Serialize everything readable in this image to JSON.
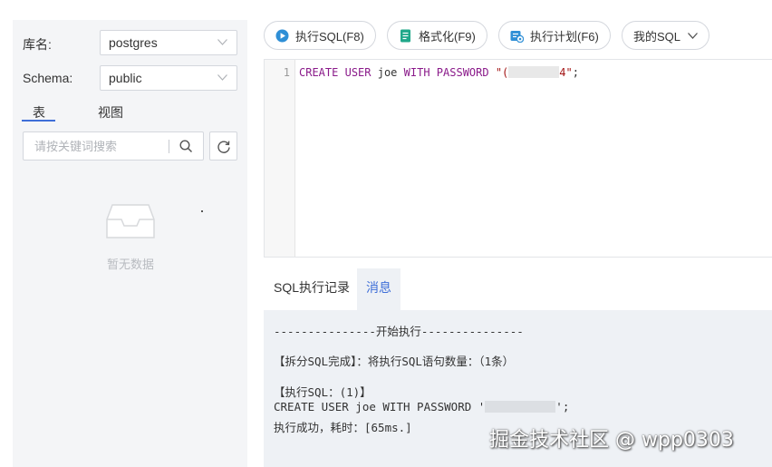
{
  "sidebar": {
    "db_label": "库名:",
    "db_value": "postgres",
    "schema_label": "Schema:",
    "schema_value": "public",
    "tab_table": "表",
    "tab_view": "视图",
    "search_placeholder": "请按关键词搜索",
    "empty_text": "暂无数据"
  },
  "toolbar": {
    "run_label": "执行SQL(F8)",
    "format_label": "格式化(F9)",
    "plan_label": "执行计划(F6)",
    "my_sql_label": "我的SQL"
  },
  "editor": {
    "line_number": "1",
    "kw_create": "CREATE",
    "kw_user": "USER",
    "ident": "joe",
    "kw_with": "WITH",
    "kw_password": "PASSWORD",
    "str_open": "\"(",
    "str_close": "4\"",
    "semicolon": ";"
  },
  "bottom_tabs": {
    "history": "SQL执行记录",
    "messages": "消息"
  },
  "log": {
    "line1": "---------------开始执行---------------",
    "line2": "【拆分SQL完成】：将执行SQL语句数量：（1条）",
    "line3": "【执行SQL：(1)】",
    "line4a": "CREATE USER joe WITH PASSWORD '",
    "line4b": "';",
    "line5": "执行成功，耗时：[65ms.]"
  },
  "watermark": "掘金技术社区 @ wpp0303",
  "colors": {
    "accent": "#3f6fd8",
    "keyword": "#8a1a8a",
    "panel_bg": "#f4f5f7",
    "log_bg": "#eef1f5"
  },
  "icons": [
    "play-circle-icon",
    "format-doc-icon",
    "plan-icon",
    "chevron-down-icon",
    "search-icon",
    "refresh-icon",
    "empty-inbox-icon"
  ]
}
